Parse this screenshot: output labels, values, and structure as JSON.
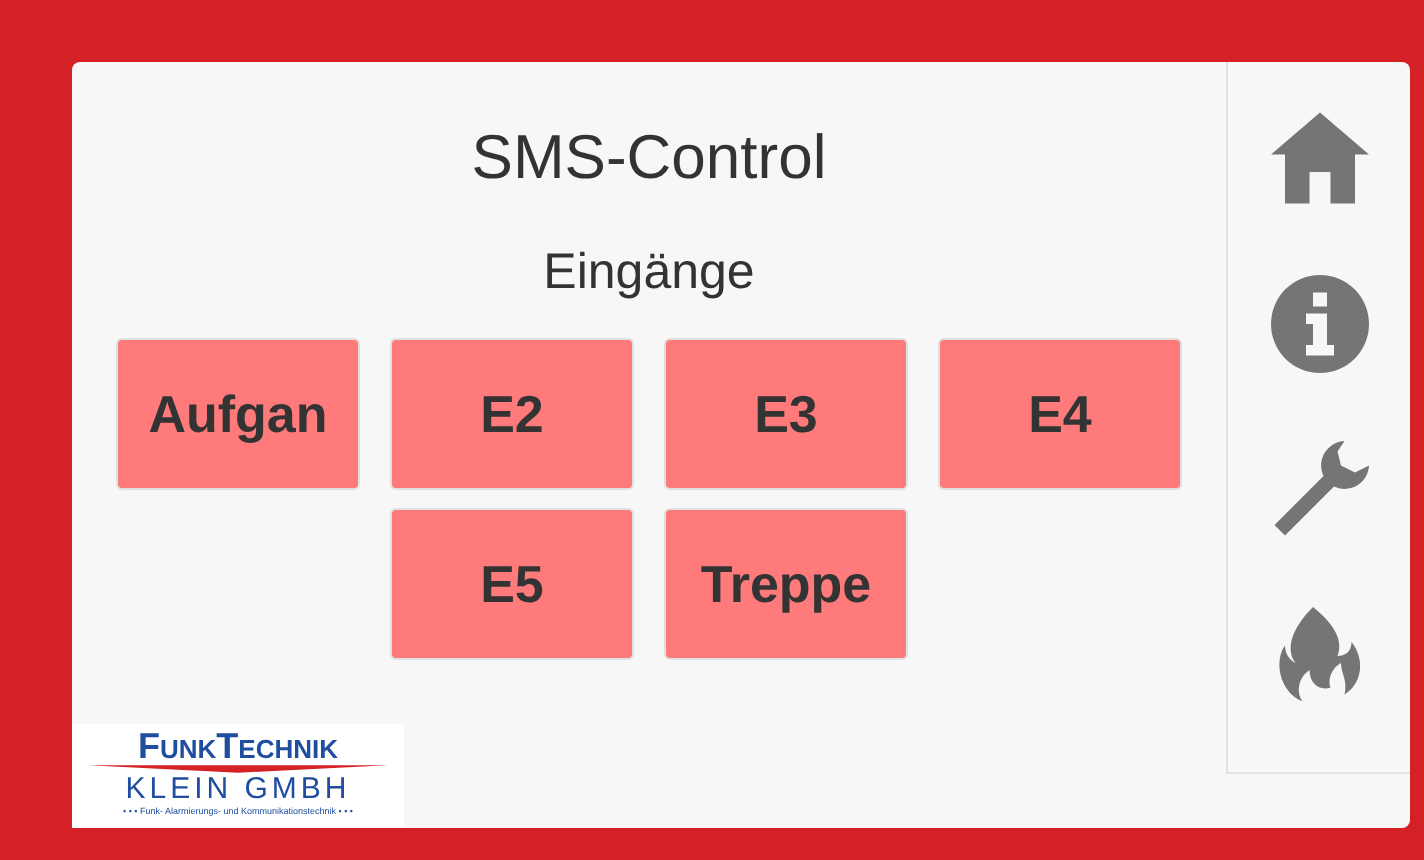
{
  "title": "SMS-Control",
  "section": "Eingänge",
  "inputs": [
    {
      "label": "Aufgan"
    },
    {
      "label": "E2"
    },
    {
      "label": "E3"
    },
    {
      "label": "E4"
    },
    {
      "label": "E5"
    },
    {
      "label": "Treppe"
    }
  ],
  "sidebar": {
    "items": [
      {
        "kind": "home"
      },
      {
        "kind": "info"
      },
      {
        "kind": "wrench"
      },
      {
        "kind": "fire"
      }
    ]
  },
  "logo": {
    "line_1": "FunkTechnik",
    "line_2": "KLEIN GMBH",
    "tagline": "• • •  Funk- Alarmierungs- und Kommunikationstechnik  • • •"
  }
}
